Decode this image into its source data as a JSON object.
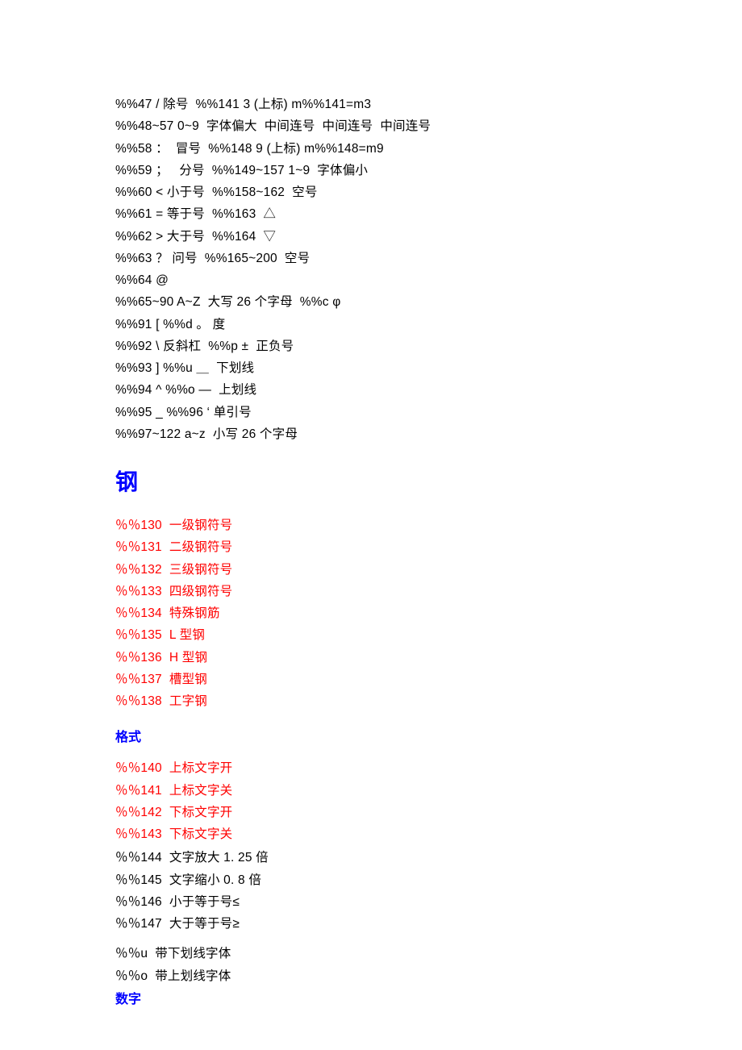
{
  "top_block": [
    "%%47 / 除号  %%141 3 (上标) m%%141=m3",
    "%%48~57 0~9  字体偏大  中间连号  中间连号  中间连号",
    "%%58 ：  冒号  %%148 9 (上标) m%%148=m9",
    "%%59 ；   分号  %%149~157 1~9  字体偏小",
    "%%60 < 小于号  %%158~162  空号",
    "%%61 = 等于号  %%163  △",
    "%%62 > 大于号  %%164  ▽",
    "%%63 ？ 问号  %%165~200  空号",
    "%%64 @",
    "%%65~90 A~Z  大写 26 个字母  %%c φ",
    "%%91 [ %%d 。 度",
    "%%92 \\ 反斜杠  %%p ±  正负号",
    "%%93 ] %%u ＿  下划线",
    "%%94 ^ %%o —  上划线",
    "%%95 _ %%96 ‘ 单引号",
    "%%97~122 a~z  小写 26 个字母"
  ],
  "heading_steel": "钢",
  "steel_list": [
    "％％130  一级钢符号",
    "％％131  二级钢符号",
    "％％132  三级钢符号",
    "％％133  四级钢符号",
    "％％134  特殊钢筋",
    "％％135  L 型钢",
    "％％136  H 型钢",
    "％％137  槽型钢",
    "％％138  工字钢"
  ],
  "heading_format": "格式",
  "format_red": [
    "％％140  上标文字开",
    "％％141  上标文字关",
    "％％142  下标文字开",
    "％％143  下标文字关"
  ],
  "format_black": [
    "％％144  文字放大 1. 25 倍",
    "％％145  文字缩小 0. 8 倍",
    "％％146  小于等于号≤",
    "％％147  大于等于号≥"
  ],
  "underline_block": [
    "％％u  带下划线字体",
    "％％o  带上划线字体"
  ],
  "heading_number": "数字"
}
